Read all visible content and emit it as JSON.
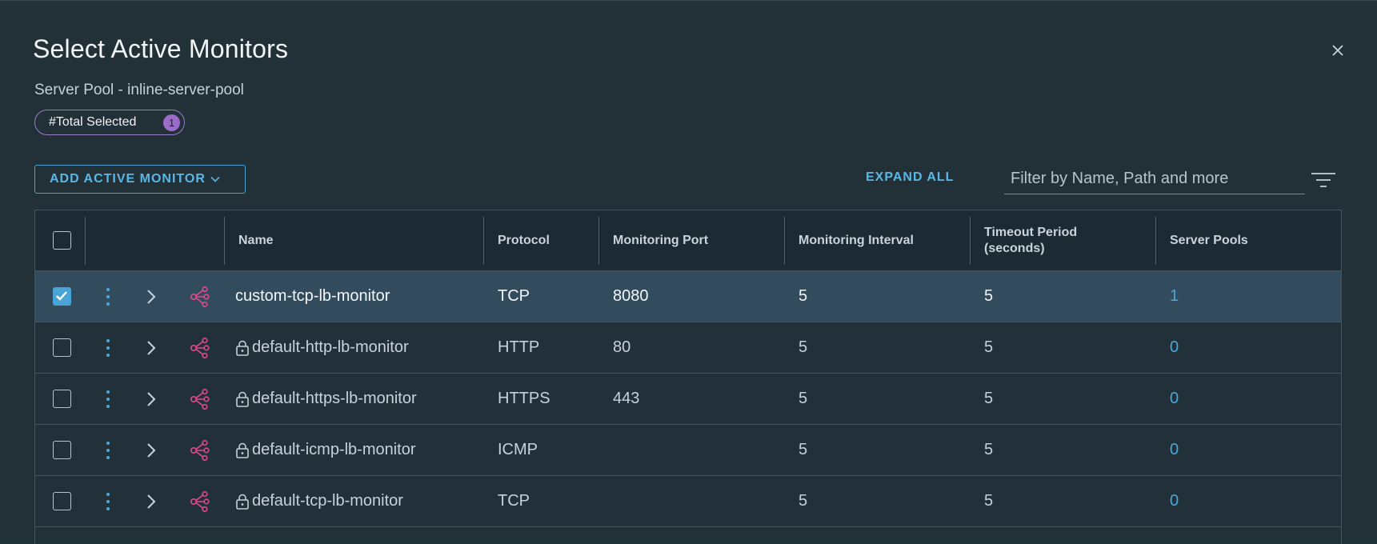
{
  "dialog": {
    "title": "Select Active Monitors",
    "subtitle": "Server Pool - inline-server-pool",
    "total_selected_label": "#Total Selected",
    "total_selected_count": "1"
  },
  "toolbar": {
    "add_label": "ADD ACTIVE MONITOR",
    "expand_all_label": "EXPAND ALL",
    "filter_placeholder": "Filter by Name, Path and more"
  },
  "table": {
    "columns": {
      "name": "Name",
      "protocol": "Protocol",
      "port": "Monitoring Port",
      "interval": "Monitoring Interval",
      "timeout_line1": "Timeout Period",
      "timeout_line2": "(seconds)",
      "pools": "Server Pools"
    },
    "rows": [
      {
        "name": "custom-tcp-lb-monitor",
        "protocol": "TCP",
        "port": "8080",
        "interval": "5",
        "timeout": "5",
        "pools": "1",
        "selected": true,
        "locked": false
      },
      {
        "name": "default-http-lb-monitor",
        "protocol": "HTTP",
        "port": "80",
        "interval": "5",
        "timeout": "5",
        "pools": "0",
        "selected": false,
        "locked": true
      },
      {
        "name": "default-https-lb-monitor",
        "protocol": "HTTPS",
        "port": "443",
        "interval": "5",
        "timeout": "5",
        "pools": "0",
        "selected": false,
        "locked": true
      },
      {
        "name": "default-icmp-lb-monitor",
        "protocol": "ICMP",
        "port": "",
        "interval": "5",
        "timeout": "5",
        "pools": "0",
        "selected": false,
        "locked": true
      },
      {
        "name": "default-tcp-lb-monitor",
        "protocol": "TCP",
        "port": "",
        "interval": "5",
        "timeout": "5",
        "pools": "0",
        "selected": false,
        "locked": true
      }
    ]
  },
  "icons": {
    "close": "close-icon",
    "chevron": "chevron-down-icon",
    "filter": "filter-icon",
    "kebab": "kebab-icon",
    "expand": "chevron-right-icon",
    "pool": "network-share-icon",
    "lock": "lock-icon"
  },
  "colors": {
    "accent": "#49a5d6",
    "pool_icon": "#e04a8c",
    "badge": "#9b6ccc",
    "selected_row": "#324b5d"
  }
}
